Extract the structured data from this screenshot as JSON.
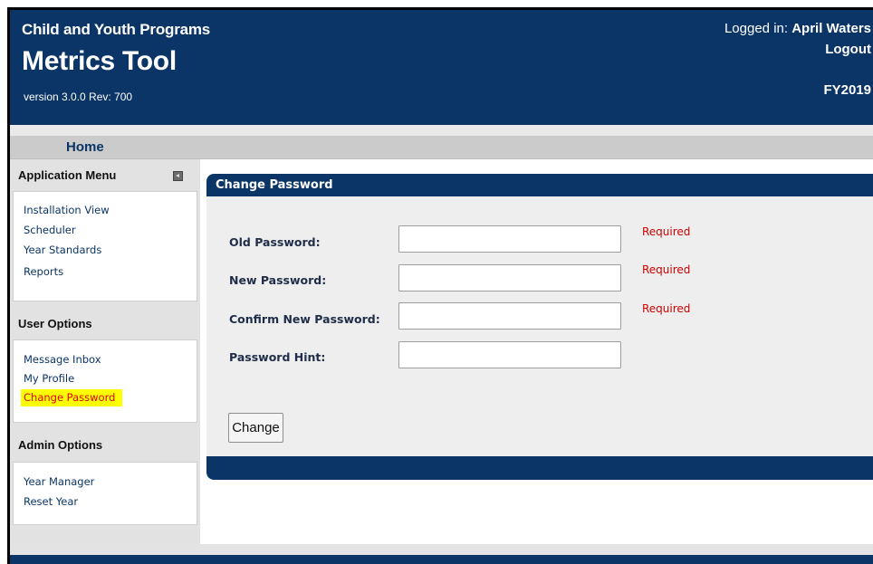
{
  "header": {
    "org": "Child and Youth Programs",
    "app_title": "Metrics Tool",
    "version": "version 3.0.0 Rev: 700",
    "logged_in_label": "Logged in: ",
    "user_name": "April Waters",
    "logout": "Logout",
    "fiscal_year": "FY2019"
  },
  "nav": {
    "home": "Home"
  },
  "sidebar": {
    "application_menu": {
      "title": "Application Menu",
      "items": [
        "Installation View",
        "Scheduler",
        "Year Standards",
        "Reports"
      ]
    },
    "user_options": {
      "title": "User Options",
      "items": [
        "Message Inbox",
        "My Profile",
        "Change Password"
      ],
      "active": "Change Password"
    },
    "admin_options": {
      "title": "Admin Options",
      "items": [
        "Year Manager",
        "Reset Year"
      ]
    }
  },
  "main": {
    "title": "Change Password",
    "fields": [
      {
        "label": "Old Password:",
        "value": "",
        "required": "Required"
      },
      {
        "label": "New Password:",
        "value": "",
        "required": "Required"
      },
      {
        "label": "Confirm New Password:",
        "value": "",
        "required": "Required"
      },
      {
        "label": "Password Hint:",
        "value": "",
        "required": ""
      }
    ],
    "submit_label": "Change"
  },
  "colors": {
    "brand_navy": "#0b3567",
    "required_red": "#cc0000",
    "highlight_yellow": "#ffff00"
  }
}
